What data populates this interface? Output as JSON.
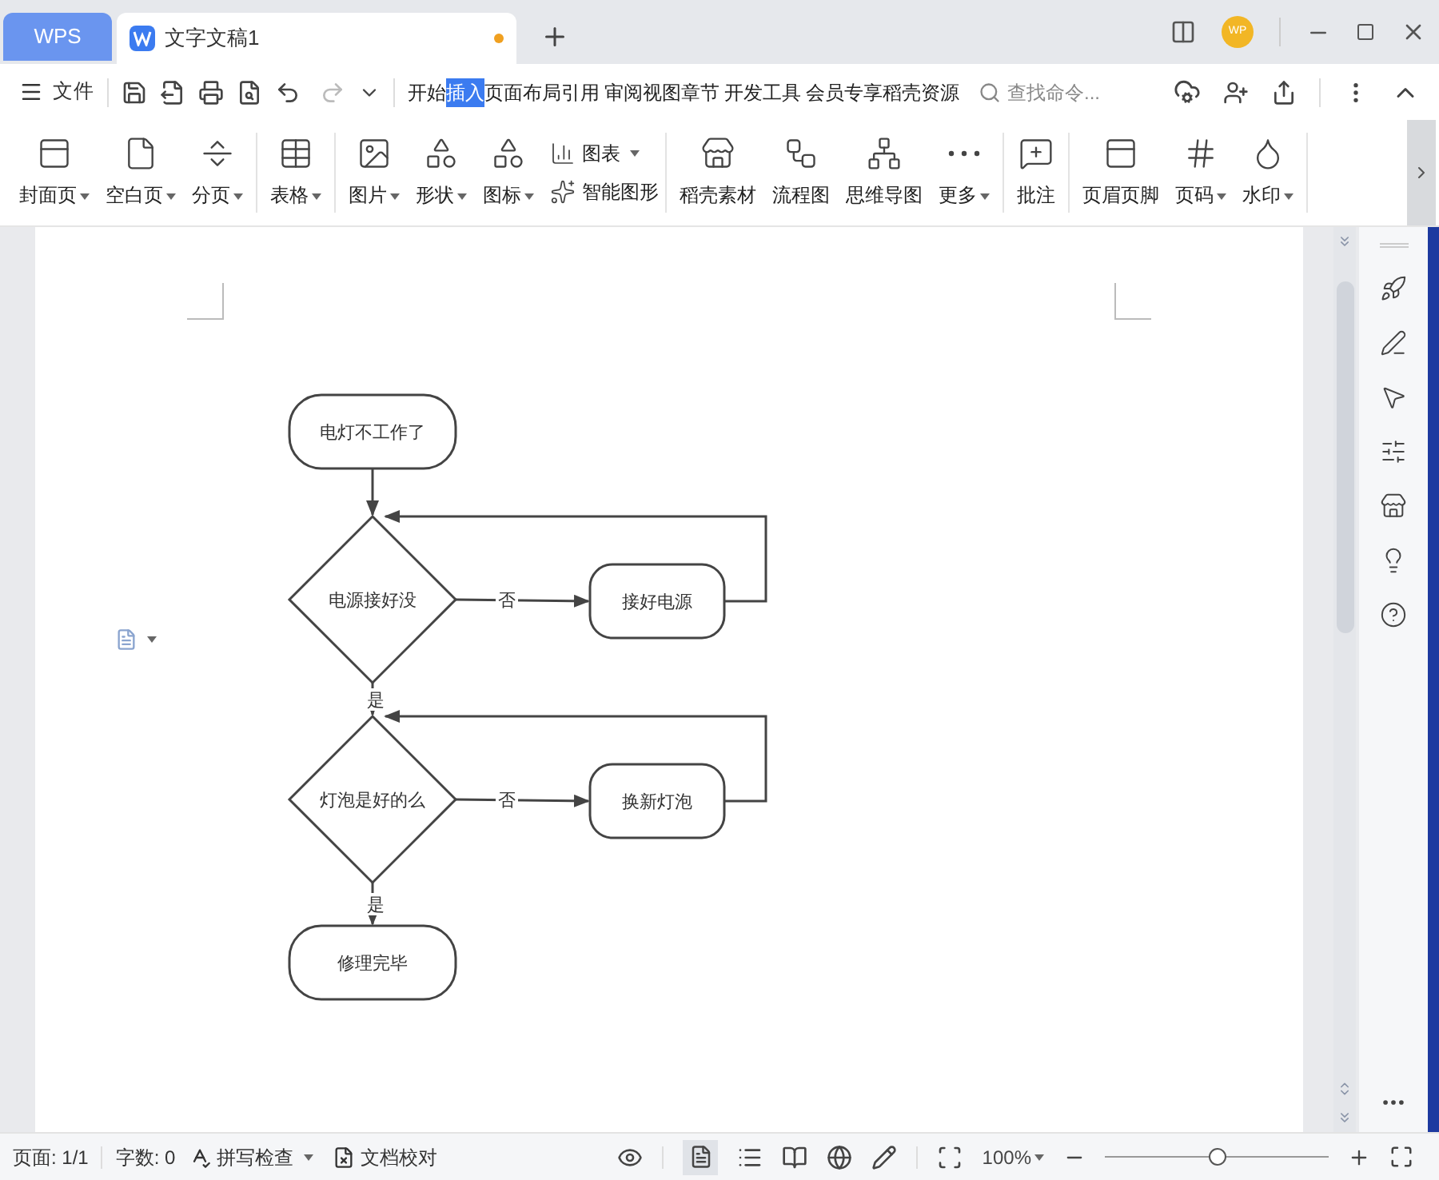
{
  "tabs": [
    {
      "label": "WPS",
      "kind": "home",
      "selected": false
    },
    {
      "label": "文字文稿1",
      "kind": "doc",
      "selected": true,
      "unsaved": true
    }
  ],
  "avatar": "WP",
  "menu": {
    "file": "文件",
    "items": [
      {
        "label": "开始",
        "selected": false
      },
      {
        "label": "插入",
        "selected": true
      },
      {
        "label": "页面布局",
        "selected": false
      },
      {
        "label": "引用",
        "selected": false
      },
      {
        "label": "审阅",
        "selected": false
      },
      {
        "label": "视图",
        "selected": false
      },
      {
        "label": "章节",
        "selected": false
      },
      {
        "label": "开发工具",
        "selected": false
      },
      {
        "label": "会员专享",
        "selected": false
      },
      {
        "label": "稻壳资源",
        "selected": false
      }
    ],
    "search": {
      "placeholder": "查找命令..."
    }
  },
  "ribbon": {
    "groups": [
      {
        "items": [
          {
            "label": "封面页",
            "kind": "large",
            "dropdown": true
          },
          {
            "label": "空白页",
            "kind": "large",
            "dropdown": true
          },
          {
            "label": "分页",
            "kind": "large",
            "dropdown": true
          }
        ]
      },
      {
        "items": [
          {
            "label": "表格",
            "kind": "large",
            "dropdown": true
          }
        ]
      },
      {
        "items": [
          {
            "label": "图片",
            "kind": "large",
            "dropdown": true
          },
          {
            "label": "形状",
            "kind": "large",
            "dropdown": true
          },
          {
            "label": "图标",
            "kind": "large",
            "dropdown": true
          },
          {
            "label": "图表",
            "kind": "small",
            "dropdown": true
          },
          {
            "label": "智能图形",
            "kind": "small",
            "dropdown": false
          }
        ]
      },
      {
        "items": [
          {
            "label": "稻壳素材",
            "kind": "large",
            "dropdown": false
          },
          {
            "label": "流程图",
            "kind": "large",
            "dropdown": false
          },
          {
            "label": "思维导图",
            "kind": "large",
            "dropdown": false
          },
          {
            "label": "更多",
            "kind": "large",
            "dropdown": true
          }
        ]
      },
      {
        "items": [
          {
            "label": "批注",
            "kind": "large",
            "dropdown": false
          }
        ]
      },
      {
        "items": [
          {
            "label": "页眉页脚",
            "kind": "large",
            "dropdown": false
          },
          {
            "label": "页码",
            "kind": "large",
            "dropdown": true
          },
          {
            "label": "水印",
            "kind": "large",
            "dropdown": true
          }
        ]
      }
    ]
  },
  "flowchart": {
    "nodes": [
      {
        "text": "电灯不工作了",
        "kind": "terminal"
      },
      {
        "text": "电源接好没",
        "kind": "decision"
      },
      {
        "text": "接好电源",
        "kind": "process"
      },
      {
        "text": "灯泡是好的么",
        "kind": "decision"
      },
      {
        "text": "换新灯泡",
        "kind": "process"
      },
      {
        "text": "修理完毕",
        "kind": "terminal"
      }
    ],
    "edges": [
      {
        "kind": "down"
      },
      {
        "kind": "right",
        "label": "否"
      },
      {
        "kind": "loop"
      },
      {
        "kind": "down",
        "label": "是"
      },
      {
        "kind": "right",
        "label": "否"
      },
      {
        "kind": "loop"
      },
      {
        "kind": "down",
        "label": "是"
      }
    ]
  },
  "status_bar": {
    "page": "页面: 1/1",
    "words": "字数: 0",
    "spell_check": "拼写检查",
    "proofread": "文档校对",
    "zoom": "100%",
    "zoom_slider": {
      "level": 0.5
    }
  }
}
